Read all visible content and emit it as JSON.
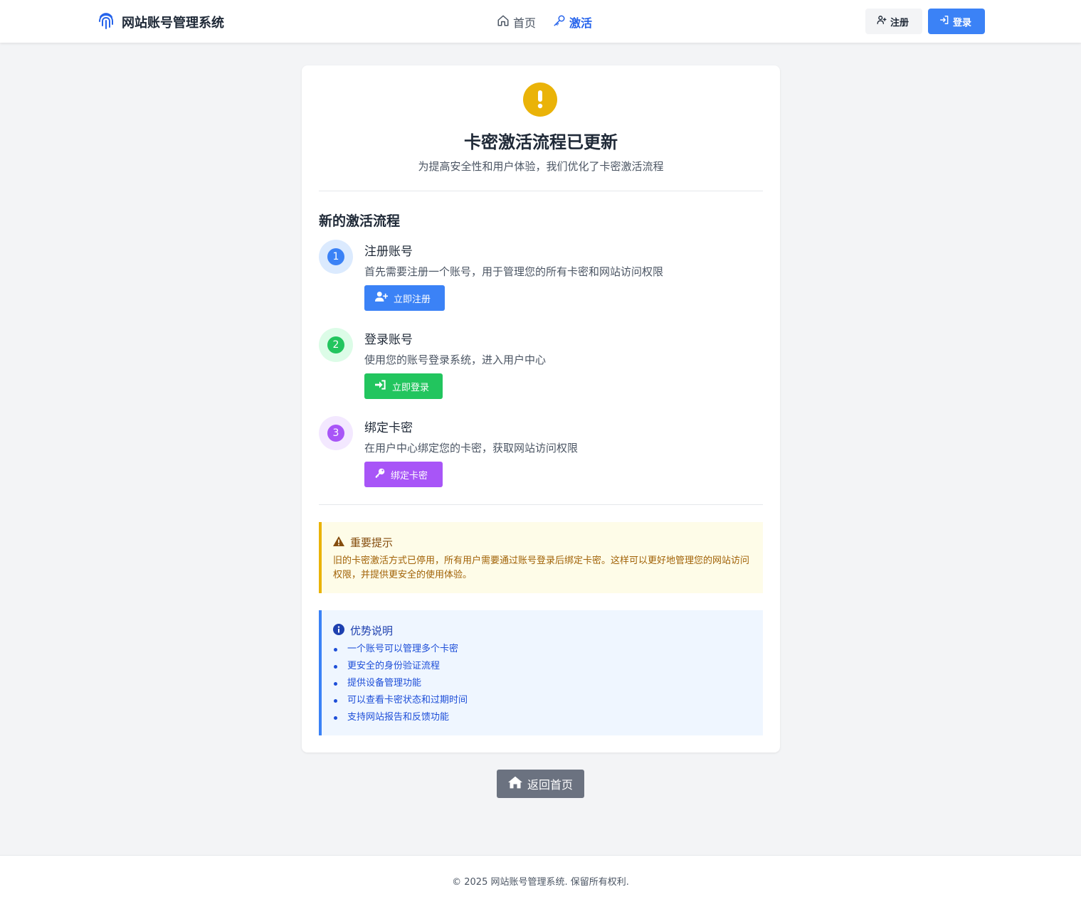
{
  "header": {
    "brand_title": "网站账号管理系统",
    "nav": [
      {
        "label": "首页",
        "icon": "home-icon",
        "active": false
      },
      {
        "label": "激活",
        "icon": "key-icon",
        "active": true
      }
    ],
    "register_label": "注册",
    "login_label": "登录"
  },
  "card": {
    "title": "卡密激活流程已更新",
    "subtitle": "为提高安全性和用户体验，我们优化了卡密激活流程",
    "section_title": "新的激活流程",
    "steps": [
      {
        "number": "1",
        "title": "注册账号",
        "desc": "首先需要注册一个账号，用于管理您的所有卡密和网站访问权限",
        "button": "立即注册",
        "color": "#3b82f6",
        "ring": "#dbeafe"
      },
      {
        "number": "2",
        "title": "登录账号",
        "desc": "使用您的账号登录系统，进入用户中心",
        "button": "立即登录",
        "color": "#22c55e",
        "ring": "#dcfce7"
      },
      {
        "number": "3",
        "title": "绑定卡密",
        "desc": "在用户中心绑定您的卡密，获取网站访问权限",
        "button": "绑定卡密",
        "color": "#a855f7",
        "ring": "#f3e8ff"
      }
    ],
    "important": {
      "title": "重要提示",
      "text": "旧的卡密激活方式已停用，所有用户需要通过账号登录后绑定卡密。这样可以更好地管理您的网站访问权限，并提供更安全的使用体验。"
    },
    "advantages": {
      "title": "优势说明",
      "items": [
        "一个账号可以管理多个卡密",
        "更安全的身份验证流程",
        "提供设备管理功能",
        "可以查看卡密状态和过期时间",
        "支持网站报告和反馈功能"
      ]
    }
  },
  "home_button": "返回首页",
  "footer": "© 2025 网站账号管理系统. 保留所有权利."
}
